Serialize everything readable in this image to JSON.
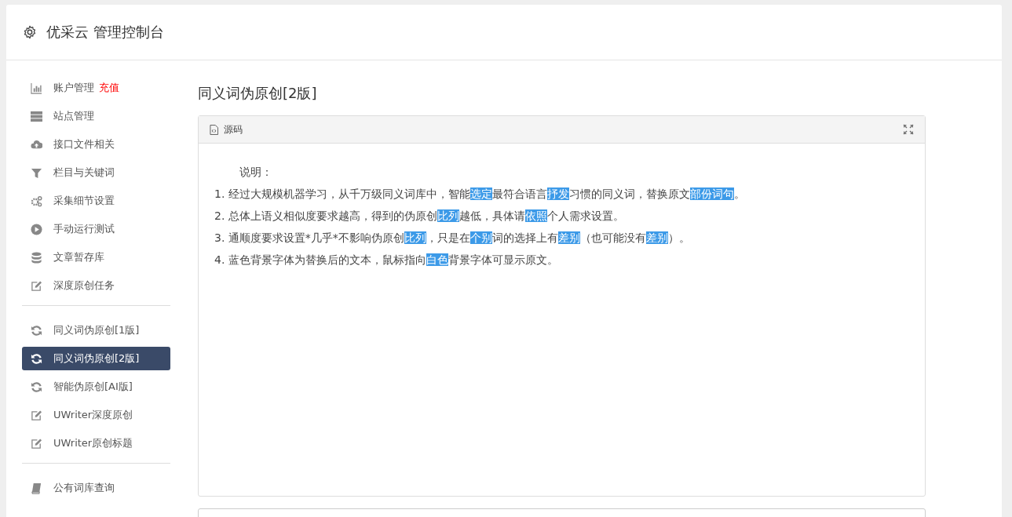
{
  "header": {
    "title": "优采云 管理控制台"
  },
  "sidebar": {
    "groups": [
      {
        "items": [
          {
            "label": "账户管理",
            "badge": "充值",
            "kind": "chart",
            "selected": false
          },
          {
            "label": "站点管理",
            "kind": "server",
            "selected": false
          },
          {
            "label": "接口文件相关",
            "kind": "cloud",
            "selected": false
          },
          {
            "label": "栏目与关键词",
            "kind": "filter",
            "selected": false
          },
          {
            "label": "采集细节设置",
            "kind": "gears",
            "selected": false
          },
          {
            "label": "手动运行测试",
            "kind": "play",
            "selected": false
          },
          {
            "label": "文章暂存库",
            "kind": "database",
            "selected": false
          },
          {
            "label": "深度原创任务",
            "kind": "edit",
            "selected": false
          }
        ]
      },
      {
        "items": [
          {
            "label": "同义词伪原创[1版]",
            "kind": "refresh",
            "selected": false
          },
          {
            "label": "同义词伪原创[2版]",
            "kind": "refresh",
            "selected": true
          },
          {
            "label": "智能伪原创[AI版]",
            "kind": "refresh",
            "selected": false
          },
          {
            "label": "UWriter深度原创",
            "kind": "edit",
            "selected": false
          },
          {
            "label": "UWriter原创标题",
            "kind": "edit",
            "selected": false
          }
        ]
      },
      {
        "items": [
          {
            "label": "公有词库查询",
            "kind": "book",
            "selected": false
          }
        ]
      }
    ]
  },
  "page_title": "同义词伪原创[2版]",
  "editor": {
    "toolbar": {
      "source_button": "源码"
    },
    "heading": "说明：",
    "lines": [
      [
        {
          "text": "1. 经过大规模机器学习，从千万级同义词库中，智能",
          "replaced": false
        },
        {
          "text": "选定",
          "replaced": true
        },
        {
          "text": "最符合语言",
          "replaced": false
        },
        {
          "text": "抒发",
          "replaced": true
        },
        {
          "text": "习惯的同义词，替换原文",
          "replaced": false
        },
        {
          "text": "部份",
          "replaced": true
        },
        {
          "text": "词句",
          "replaced": true
        },
        {
          "text": "。",
          "replaced": false
        }
      ],
      [
        {
          "text": "2. 总体上语义相似度要求越高，得到的伪原创",
          "replaced": false
        },
        {
          "text": "比列",
          "replaced": true
        },
        {
          "text": "越低，具体请",
          "replaced": false
        },
        {
          "text": "依照",
          "replaced": true
        },
        {
          "text": "个人需求设置。",
          "replaced": false
        }
      ],
      [
        {
          "text": "3. 通顺度要求设置*几乎*不影响伪原创",
          "replaced": false
        },
        {
          "text": "比列",
          "replaced": true
        },
        {
          "text": "，只是在",
          "replaced": false
        },
        {
          "text": "个别",
          "replaced": true
        },
        {
          "text": "词的选择上有",
          "replaced": false
        },
        {
          "text": "差别",
          "replaced": true
        },
        {
          "text": "（也可能没有",
          "replaced": false
        },
        {
          "text": "差别",
          "replaced": true
        },
        {
          "text": "）。",
          "replaced": false
        }
      ],
      [
        {
          "text": "4. 蓝色背景字体为替换后的文本，鼠标指向",
          "replaced": false
        },
        {
          "text": "白色",
          "replaced": true
        },
        {
          "text": "背景字体可显示原文。",
          "replaced": false
        }
      ]
    ]
  }
}
